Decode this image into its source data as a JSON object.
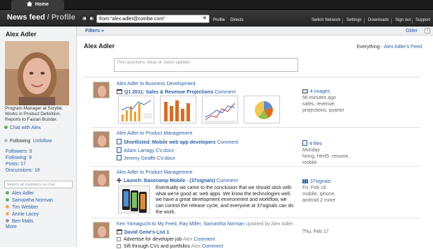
{
  "topbar": {
    "home_label": "Home"
  },
  "header": {
    "title_main": "News feed",
    "title_slash": " / ",
    "title_sub": "Profile",
    "search_value": "from:\"alex.adler@cotribe.com\"",
    "links": [
      "Profile",
      "Directs"
    ],
    "right_links": [
      "Switch Network",
      "Settings",
      "Downloads",
      "Sign out",
      "Support"
    ]
  },
  "sidebar": {
    "name": "Alex Adler",
    "bio": "Program Manager at Scrybe. Works in Product Definition. Reports to Faizan Buzdar.",
    "chat_label": "Chat with Alex",
    "following_label": "Following",
    "unfollow_label": "Unfollow",
    "stats": [
      "Followers: 9",
      "Following: 9",
      "Posts: 17",
      "Discussions: 18"
    ],
    "search_placeholder": "Search all members on chat",
    "members": [
      {
        "name": "Alex Adler",
        "status": "green"
      },
      {
        "name": "Samantha Norman",
        "status": "green"
      },
      {
        "name": "Tim Webber",
        "status": "orange"
      },
      {
        "name": "Annie Lacey",
        "status": "orange"
      },
      {
        "name": "Ben Malis",
        "status": "grey"
      }
    ],
    "more_label": "More"
  },
  "filters": {
    "filters_label": "Filters »",
    "older_label": "Older"
  },
  "main": {
    "title": "Alex Adler",
    "everything_label": "Everything",
    "feed_link": "Alex Adler's Feed",
    "post_placeholder": "Post questions, ideas or status updates"
  },
  "feed": [
    {
      "route": "Alex Adler to Business Development",
      "title": "Q1 2011: Sales & Revenue Projections",
      "comment": "Comment",
      "meta_head": "4 images",
      "meta_lines": [
        "56 minutes ago",
        "sales, revenue,",
        "projections, quarter"
      ]
    },
    {
      "route": "Alex Adler to Product Management",
      "title": "Shortlisted: Mobile web app developers",
      "comment": "Comment",
      "files": [
        "Adam Larragy CV.docx",
        "Jeremy Giraffe CV.docx"
      ],
      "meta_head": "4 files",
      "meta_lines": [
        "Monday",
        "hiring, html5, resume,",
        "mobile"
      ]
    },
    {
      "route": "Alex Adler to Product Management",
      "title": "Launch: Basecamp Mobile - (37signals)",
      "comment": "Comment",
      "description": "Eventually we came to the conclusion that we should stick with what we're good at: web apps. We know the technologies well, we have a great development environment and workflow, we can control the release cycle, and everyone at 37signals can do the work.",
      "meta_head": "37signals",
      "meta_lines": [
        "Fri, Feb 18",
        "mobile, iphone,",
        "android 2 more"
      ]
    },
    {
      "route": "Ken Yamaguchi to My Feed, Ray Miller, Samantha Norman",
      "updated": "updated by Alex Adler",
      "title": "David Gene's List 1",
      "items": [
        {
          "label": "Advertise for developer job",
          "who": "Alex",
          "comment": "Comment"
        },
        {
          "label": "Sift through CVs and portfolios",
          "who": "Alex",
          "comment": "Comment"
        }
      ],
      "meta_head": "",
      "meta_lines": [
        "Thu, Feb 17"
      ]
    }
  ],
  "icons": {
    "home": "home-icon",
    "back": "back-arrow-icon",
    "forward": "forward-arrow-icon",
    "clear": "clear-search-icon",
    "calendar": "calendar-icon",
    "document": "document-icon",
    "plugin": "plugin-icon",
    "images": "images-icon",
    "files": "files-icon",
    "site": "site-icon"
  },
  "colors": {
    "link": "#2a5fa8",
    "online": "#5cb85c",
    "away": "#f0ad4e",
    "offline": "#999999",
    "topbar": "#1b1b1b"
  }
}
